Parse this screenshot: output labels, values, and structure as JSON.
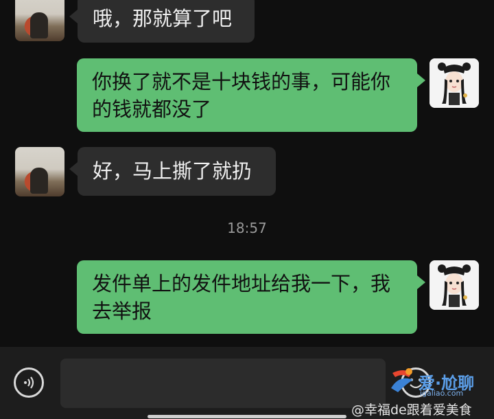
{
  "messages": [
    {
      "sender": "contact",
      "text": "哦，那就算了吧"
    },
    {
      "sender": "me",
      "lines": [
        "你换了就不是十块钱的事，可能你",
        "的钱就都没了"
      ]
    },
    {
      "sender": "contact",
      "text": "好，马上撕了就扔"
    },
    {
      "sender": "me",
      "lines": [
        "发件单上的发件地址给我一下，我",
        "去举报"
      ]
    }
  ],
  "timestamp": "18:57",
  "watermark": {
    "site": "爱·尬聊",
    "url": "igaliao.com",
    "weibo_handle": "@幸福de跟着爱美食"
  },
  "colors": {
    "outgoing_bubble": "#5fbe73",
    "incoming_bubble": "#2d2d2d",
    "background": "#0f0f0f"
  },
  "icons": {
    "voice": "voice-wave-icon",
    "emoji": "emoji-icon"
  }
}
